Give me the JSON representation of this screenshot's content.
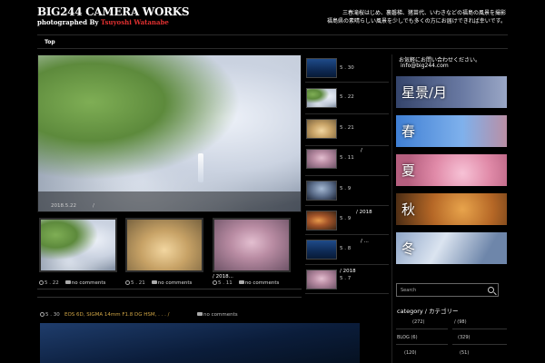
{
  "header": {
    "title": "BIG244 CAMERA WORKS",
    "subtitle_prefix": "photographed By ",
    "subtitle_name": "Tsuyoshi Watanabe",
    "intro_line1": "三春滝桜はじめ、裏磐梯、猪苗代、いわきなどの福島の風景を撮影",
    "intro_line2": "福島県の素晴らしい風景を少しでも多くの方にお届けできれば幸いです。"
  },
  "nav": {
    "items": [
      "Top",
      "",
      "",
      "",
      "",
      "",
      "",
      ""
    ]
  },
  "hero": {
    "title": "",
    "date": "2018.5.22",
    "sep": "/"
  },
  "thumbs": [
    {
      "title": "",
      "date": "5 . 22",
      "comments": "no comments"
    },
    {
      "title": "",
      "date": "5 . 21",
      "comments": "no comments"
    },
    {
      "title": "/ 2018...",
      "date": "5 . 11",
      "comments": "no comments"
    }
  ],
  "post": {
    "title": "",
    "date": "5 . 30",
    "tags": "EOS 6D, SIGMA 14mm F1.8 DG HSM, . . . /",
    "comments": "no comments"
  },
  "list": [
    {
      "date": "5 . 30",
      "title": ""
    },
    {
      "date": "5 . 22",
      "title": ""
    },
    {
      "date": "5 . 21",
      "title": ""
    },
    {
      "date": "5 . 11",
      "title": "/"
    },
    {
      "date": "5 . 9",
      "title": ""
    },
    {
      "date": "5 . 9",
      "title": "/ 2018"
    },
    {
      "date": "5 . 8",
      "title": "/ ..."
    },
    {
      "date": "5 . 7",
      "title": "/ 2018"
    }
  ],
  "sidebar": {
    "contact_line1": "お気軽にお問い合わせください。",
    "contact_email": "info@big244.com",
    "banners": [
      "星景/月",
      "春",
      "夏",
      "秋",
      "冬"
    ],
    "search_heading": "",
    "search_placeholder": "Search",
    "category_heading": "category / カテゴリー",
    "categories": [
      {
        "label": "(272)"
      },
      {
        "label": "/ (98)"
      },
      {
        "label": "BLOG (6)"
      },
      {
        "label": "(329)"
      },
      {
        "label": "(120)"
      },
      {
        "label": "(51)"
      }
    ]
  }
}
